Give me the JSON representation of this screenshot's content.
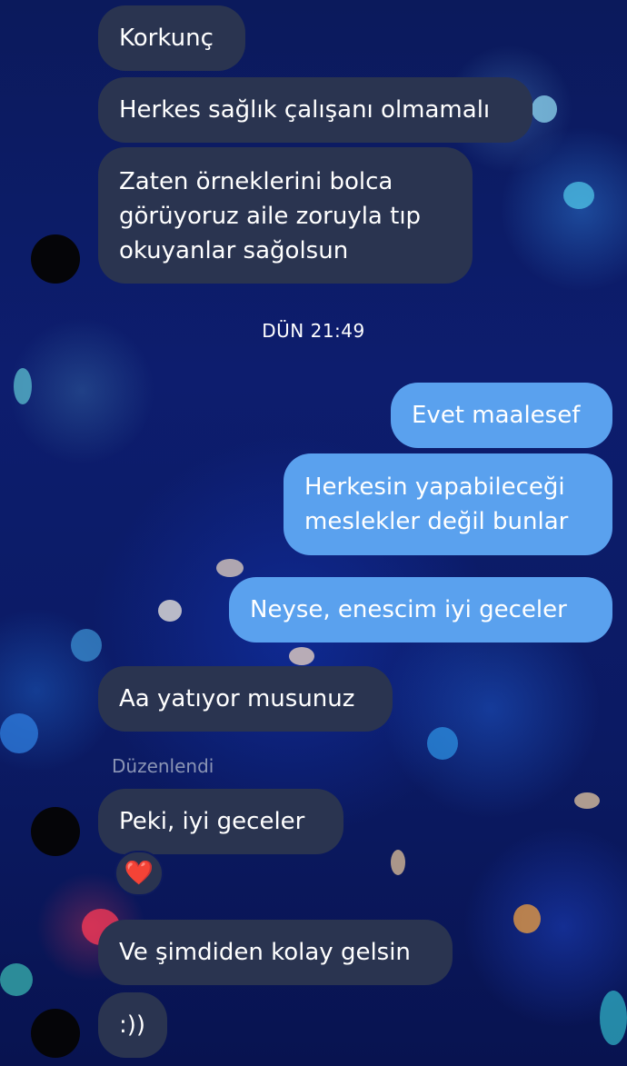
{
  "conversation": {
    "messages_before": [
      {
        "text": "Korkunç"
      },
      {
        "text": "Herkes sağlık çalışanı olmamalı"
      },
      {
        "text": "Zaten örneklerini bolca\ngörüyoruz aile zoruyla tıp\nokuyanlar sağolsun"
      }
    ],
    "timestamp": "DÜN 21:49",
    "messages_after": [
      {
        "text": "Evet maalesef"
      },
      {
        "text": "Herkesin yapabileceği\nmeslekler değil bunlar"
      },
      {
        "text": "Neyse, enescim iyi geceler"
      },
      {
        "text": "Aa yatıyor musunuz"
      },
      {
        "text": "Peki, iyi geceler"
      },
      {
        "text": "Ve şimdiden kolay gelsin"
      },
      {
        "text": ":))"
      }
    ],
    "edited_label": "Düzenlendi",
    "reaction": {
      "emoji": "❤️",
      "icon": "heart-icon",
      "color": "#e8394a"
    }
  },
  "colors": {
    "incoming_bubble": "#2a3450",
    "outgoing_bubble": "#5aa1ee",
    "background": "#0b1a5c"
  }
}
